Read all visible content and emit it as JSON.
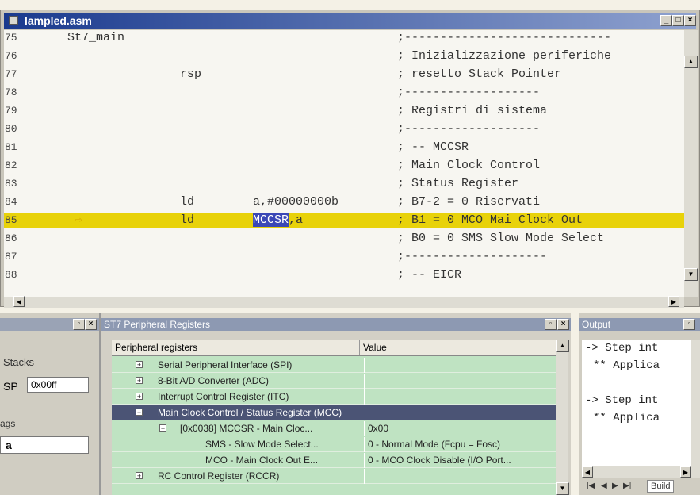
{
  "editor": {
    "title": "lampled.asm",
    "lines": [
      {
        "num": "75",
        "c1": "St7_main",
        "c2": "",
        "c3": "",
        "c4": ";-----------------------------"
      },
      {
        "num": "76",
        "c1": "",
        "c2": "",
        "c3": "",
        "c4": "; Inizializzazione periferiche"
      },
      {
        "num": "77",
        "c1": "",
        "c2": "rsp",
        "c3": "",
        "c4": "; resetto Stack Pointer"
      },
      {
        "num": "78",
        "c1": "",
        "c2": "",
        "c3": "",
        "c4": ";-------------------"
      },
      {
        "num": "79",
        "c1": "",
        "c2": "",
        "c3": "",
        "c4": "; Registri di sistema"
      },
      {
        "num": "80",
        "c1": "",
        "c2": "",
        "c3": "",
        "c4": ";-------------------"
      },
      {
        "num": "81",
        "c1": "",
        "c2": "",
        "c3": "",
        "c4": "; --     MCCSR"
      },
      {
        "num": "82",
        "c1": "",
        "c2": "",
        "c3": "",
        "c4": "; Main Clock Control"
      },
      {
        "num": "83",
        "c1": "",
        "c2": "",
        "c3": "",
        "c4": ";  Status Register"
      },
      {
        "num": "84",
        "c1": "",
        "c2": "ld",
        "c3": "a,#00000000b",
        "c4": "; B7-2 = 0 Riservati"
      },
      {
        "num": "85",
        "c1": "",
        "c2": "ld",
        "c3sel": "MCCSR",
        "c3rest": ",a",
        "c4": "; B1 = 0 MCO Mai Clock Out"
      },
      {
        "num": "86",
        "c1": "",
        "c2": "",
        "c3": "",
        "c4": "; B0 = 0 SMS Slow Mode Select"
      },
      {
        "num": "87",
        "c1": "",
        "c2": "",
        "c3": "",
        "c4": ";--------------------"
      },
      {
        "num": "88",
        "c1": "",
        "c2": "",
        "c3": "",
        "c4": "; --     EICR"
      }
    ]
  },
  "left_panel": {
    "stacks_label": "Stacks",
    "sp_label": "SP",
    "sp_value": "0x00ff",
    "flags_label": "ags",
    "reg_value": "a"
  },
  "peripheral": {
    "title": "ST7 Peripheral Registers",
    "col_name": "Peripheral registers",
    "col_value": "Value",
    "rows": [
      {
        "name": "Serial Peripheral Interface (SPI)",
        "value": "",
        "indent": 1,
        "exp": "+"
      },
      {
        "name": "8-Bit A/D Converter (ADC)",
        "value": "",
        "indent": 1,
        "exp": "+"
      },
      {
        "name": "Interrupt Control Register (ITC)",
        "value": "",
        "indent": 1,
        "exp": "+"
      },
      {
        "name": "Main Clock Control / Status Register (MCC)",
        "value": "",
        "indent": 1,
        "exp": "−"
      },
      {
        "name": "[0x0038] MCCSR - Main Cloc...",
        "value": "0x00",
        "indent": 2,
        "exp": "−"
      },
      {
        "name": "SMS - Slow Mode Select...",
        "value": "0 - Normal Mode (Fcpu = Fosc)",
        "indent": 3,
        "exp": ""
      },
      {
        "name": "MCO - Main Clock Out E...",
        "value": "0 - MCO Clock Disable (I/O Port...",
        "indent": 3,
        "exp": ""
      },
      {
        "name": "RC Control Register (RCCR)",
        "value": "",
        "indent": 1,
        "exp": "+"
      }
    ]
  },
  "output": {
    "title": "Output",
    "lines": [
      "-> Step int",
      "** Applica",
      "",
      "-> Step int",
      "** Applica"
    ],
    "tab_label": "Build"
  }
}
